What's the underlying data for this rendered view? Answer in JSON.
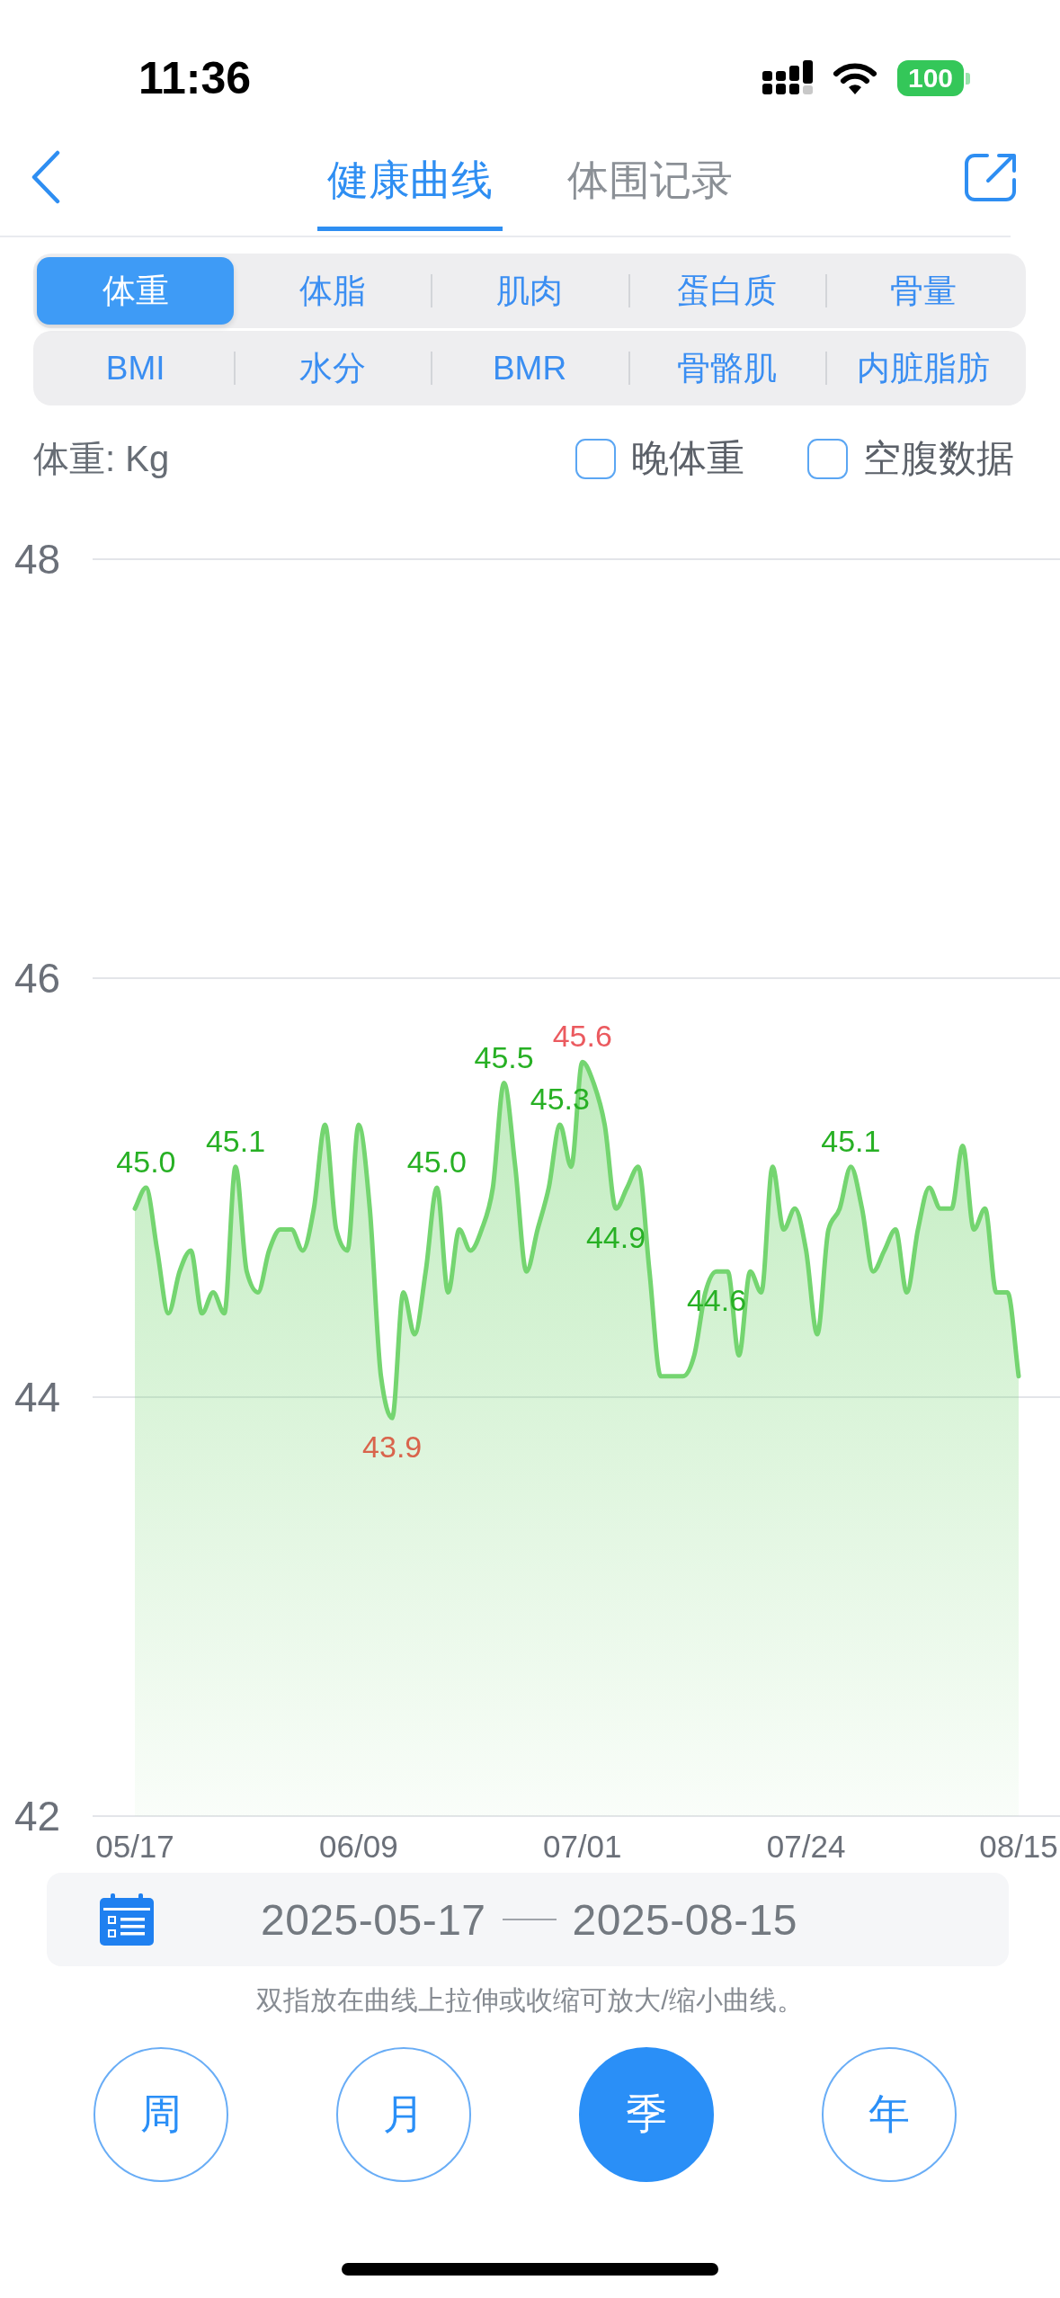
{
  "status_bar": {
    "time": "11:36",
    "battery": "100"
  },
  "nav": {
    "tabs": [
      {
        "label": "健康曲线",
        "selected": true
      },
      {
        "label": "体围记录",
        "selected": false
      }
    ]
  },
  "metric_rows": [
    {
      "items": [
        {
          "label": "体重",
          "selected": true
        },
        {
          "label": "体脂",
          "selected": false
        },
        {
          "label": "肌肉",
          "selected": false
        },
        {
          "label": "蛋白质",
          "selected": false
        },
        {
          "label": "骨量",
          "selected": false
        }
      ]
    },
    {
      "items": [
        {
          "label": "BMI",
          "selected": false
        },
        {
          "label": "水分",
          "selected": false
        },
        {
          "label": "BMR",
          "selected": false
        },
        {
          "label": "骨骼肌",
          "selected": false
        },
        {
          "label": "内脏脂肪",
          "selected": false
        }
      ]
    }
  ],
  "unit_label": "体重: Kg",
  "filters": [
    {
      "label": "晚体重",
      "checked": false
    },
    {
      "label": "空腹数据",
      "checked": false
    }
  ],
  "chart": {
    "chart_data": {
      "type": "area",
      "categories": [
        "05/17",
        null,
        null,
        null,
        null,
        null,
        null,
        null,
        null,
        null,
        null,
        null,
        null,
        null,
        null,
        null,
        null,
        null,
        null,
        null,
        "06/09",
        null,
        null,
        null,
        null,
        null,
        null,
        null,
        null,
        null,
        null,
        null,
        null,
        null,
        null,
        null,
        null,
        null,
        null,
        null,
        "07/01",
        null,
        null,
        null,
        null,
        null,
        null,
        null,
        null,
        null,
        null,
        null,
        null,
        null,
        null,
        null,
        null,
        null,
        null,
        null,
        "07/24",
        null,
        null,
        null,
        null,
        null,
        null,
        null,
        null,
        null,
        null,
        null,
        null,
        null,
        null,
        null,
        null,
        null,
        null,
        "08/15"
      ],
      "values": [
        44.9,
        45.0,
        44.7,
        44.4,
        44.6,
        44.7,
        44.4,
        44.5,
        44.4,
        45.1,
        44.6,
        44.5,
        44.7,
        44.8,
        44.8,
        44.7,
        44.9,
        45.3,
        44.8,
        44.7,
        45.3,
        44.9,
        44.1,
        43.9,
        44.5,
        44.3,
        44.6,
        45.0,
        44.5,
        44.8,
        44.7,
        44.8,
        45.0,
        45.5,
        45.1,
        44.6,
        44.8,
        45.0,
        45.3,
        45.1,
        45.6,
        45.5,
        45.3,
        44.9,
        45.0,
        45.1,
        44.6,
        44.1,
        44.1,
        44.1,
        44.2,
        44.5,
        44.6,
        44.6,
        44.2,
        44.6,
        44.5,
        45.1,
        44.8,
        44.9,
        44.7,
        44.3,
        44.8,
        44.9,
        45.1,
        44.9,
        44.6,
        44.7,
        44.8,
        44.5,
        44.8,
        45.0,
        44.9,
        44.9,
        45.2,
        44.8,
        44.9,
        44.5,
        44.5,
        44.1
      ],
      "ylim": [
        42,
        48
      ],
      "yticks": [
        42,
        44,
        46,
        48
      ],
      "value_labels": [
        null,
        "45.0",
        null,
        null,
        null,
        null,
        null,
        null,
        null,
        "45.1",
        null,
        null,
        null,
        null,
        null,
        null,
        null,
        null,
        null,
        null,
        null,
        null,
        null,
        "43.9",
        null,
        null,
        null,
        "45.0",
        null,
        null,
        null,
        null,
        null,
        "45.5",
        null,
        null,
        null,
        null,
        "45.3",
        null,
        "45.6",
        null,
        null,
        "44.9",
        null,
        null,
        null,
        null,
        null,
        null,
        null,
        null,
        "44.6",
        null,
        null,
        null,
        null,
        null,
        null,
        null,
        null,
        null,
        null,
        null,
        "45.1",
        null,
        null,
        null,
        null,
        null,
        null,
        null,
        null,
        null,
        null,
        null,
        null,
        null,
        null,
        null
      ]
    }
  },
  "date_range": {
    "start": "2025-05-17",
    "end": "2025-08-15"
  },
  "hint": "双指放在曲线上拉伸或收缩可放大/缩小曲线。",
  "periods": [
    {
      "label": "周",
      "selected": false
    },
    {
      "label": "月",
      "selected": false
    },
    {
      "label": "季",
      "selected": true
    },
    {
      "label": "年",
      "selected": false
    }
  ]
}
